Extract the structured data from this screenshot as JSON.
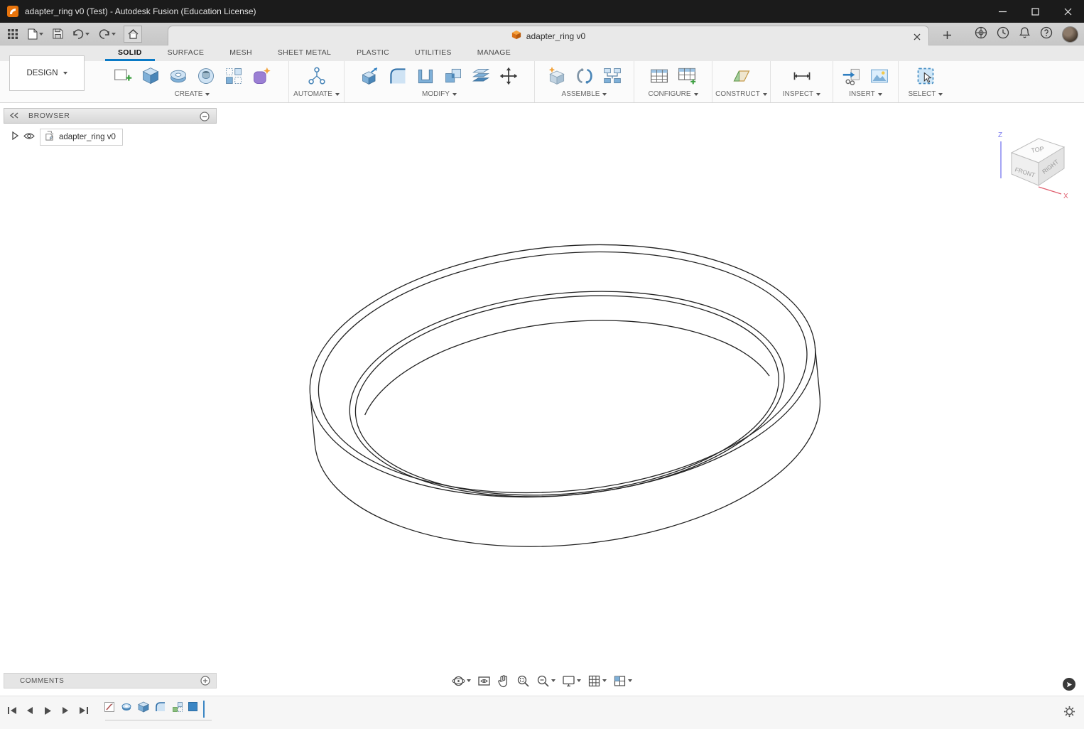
{
  "titlebar": {
    "title": "adapter_ring v0 (Test) - Autodesk Fusion (Education License)"
  },
  "tabbar": {
    "document_tab": "adapter_ring v0"
  },
  "ribbon": {
    "design": "DESIGN",
    "tabs": [
      "SOLID",
      "SURFACE",
      "MESH",
      "SHEET METAL",
      "PLASTIC",
      "UTILITIES",
      "MANAGE"
    ],
    "active_tab": "SOLID",
    "groups": [
      "CREATE",
      "AUTOMATE",
      "MODIFY",
      "ASSEMBLE",
      "CONFIGURE",
      "CONSTRUCT",
      "INSPECT",
      "INSERT",
      "SELECT"
    ]
  },
  "browser": {
    "header": "BROWSER",
    "root_item": "adapter_ring v0"
  },
  "viewcube": {
    "faces": {
      "top": "TOP",
      "front": "FRONT",
      "right": "RIGHT"
    },
    "axes": {
      "z": "Z",
      "x": "X"
    }
  },
  "comments": {
    "label": "COMMENTS"
  },
  "colors": {
    "accent": "#0a7ac6",
    "icon_blue": "#7fb0d8",
    "icon_purple": "#9b7fd4",
    "icon_orange": "#f2a33c",
    "titlebar_bg": "#1b1b1b"
  }
}
